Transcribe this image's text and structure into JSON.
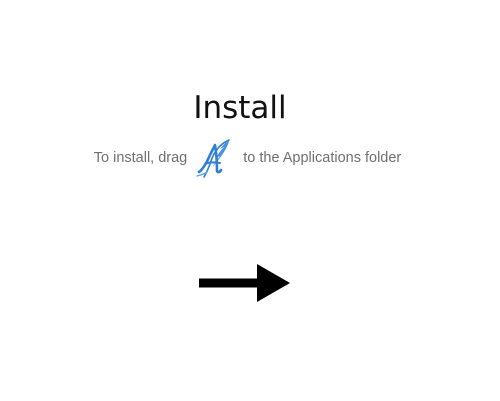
{
  "window": {
    "title": "Install"
  },
  "instruction": {
    "prefix": "To install, drag",
    "suffix": "to the Applications folder",
    "app_icon": "quill-letter-a-app-icon"
  },
  "drag_target": {
    "arrow_icon": "right-arrow-icon"
  },
  "colors": {
    "background": "#ffffff",
    "title_text": "#111111",
    "instruction_text": "#6f6f6f",
    "icon_blue": "#2f7fd4",
    "arrow": "#000000"
  }
}
